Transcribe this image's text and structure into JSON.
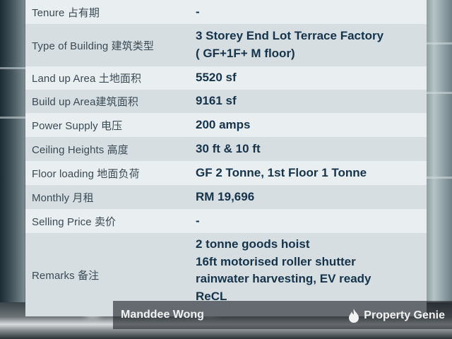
{
  "rows": [
    {
      "label": "Tenure 占有期",
      "value": "-"
    },
    {
      "label": "Type of Building 建筑类型",
      "value_lines": [
        "3 Storey End Lot Terrace Factory",
        "( GF+1F+ M floor)"
      ]
    },
    {
      "label": "Land up Area 土地面积",
      "value": "5520 sf"
    },
    {
      "label": "Build up Area建筑面积",
      "value": "9161 sf"
    },
    {
      "label": "Power Supply 电压",
      "value": "200 amps"
    },
    {
      "label": "Ceiling Heights 高度",
      "value": "30 ft & 10 ft"
    },
    {
      "label": "Floor loading 地面负荷",
      "value": "GF 2 Tonne, 1st Floor 1 Tonne"
    },
    {
      "label": "Monthly 月租",
      "value": "RM 19,696"
    },
    {
      "label": "Selling Price 卖价",
      "value": "-"
    },
    {
      "label": "Remarks 备注",
      "value_lines": [
        "2 tonne goods hoist",
        "16ft motorised roller shutter",
        "rainwater harvesting, EV ready",
        "ReCL"
      ]
    }
  ],
  "watermark": {
    "agent_name": "Manddee Wong",
    "brand": "Property Genie",
    "brand_icon": "flame-icon"
  }
}
